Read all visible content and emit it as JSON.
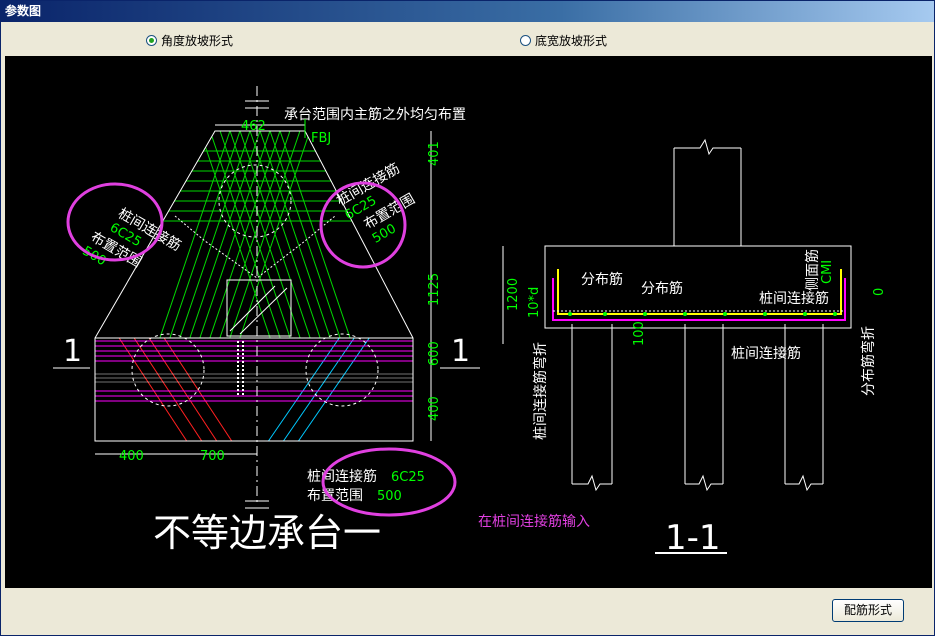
{
  "window": {
    "title": "参数图"
  },
  "options": {
    "angle_label": "角度放坡形式",
    "width_label": "底宽放坡形式",
    "selected": "angle"
  },
  "drawing": {
    "top_note": "承台范围内主筋之外均匀布置",
    "fbj": "FBJ",
    "dim_top_width": "462",
    "dim_right": [
      "401",
      "1125",
      "600",
      "400"
    ],
    "dim_bottom": [
      "400",
      "700"
    ],
    "left_label_1": "桩间连接筋",
    "left_value_1": "6C25",
    "left_label_2": "布置范围",
    "left_value_2": "500",
    "right_label_1": "桩间连接筋",
    "right_value_1": "6C25",
    "right_label_2": "布置范围",
    "right_value_2": "500",
    "bottom_label_1": "桩间连接筋",
    "bottom_value_1": "6C25",
    "bottom_label_2": "布置范围",
    "bottom_value_2": "500",
    "section_mark": "1",
    "plan_title": "不等边承台一",
    "hint": "在桩间连接筋输入",
    "section_title": "1-1",
    "sec_dist_1": "分布筋",
    "sec_dist_2": "分布筋",
    "sec_tie_top": "桩间连接筋",
    "sec_tie_bottom": "桩间连接筋",
    "sec_side": "侧面筋",
    "sec_side_val": "CMI",
    "sec_height": "1200",
    "sec_anchor": "10*d",
    "sec_100": "100",
    "sec_bend_left": "桩间连接筋弯折",
    "sec_bend_right": "分布筋弯折",
    "sec_bend_val": "0"
  },
  "buttons": {
    "config": "配筋形式"
  },
  "colors": {
    "green": "#00ff00",
    "magenta": "#ff00ff",
    "yellow": "#ffff00",
    "red": "#ff2020",
    "cyan": "#00c8ff",
    "white": "#ffffff"
  }
}
